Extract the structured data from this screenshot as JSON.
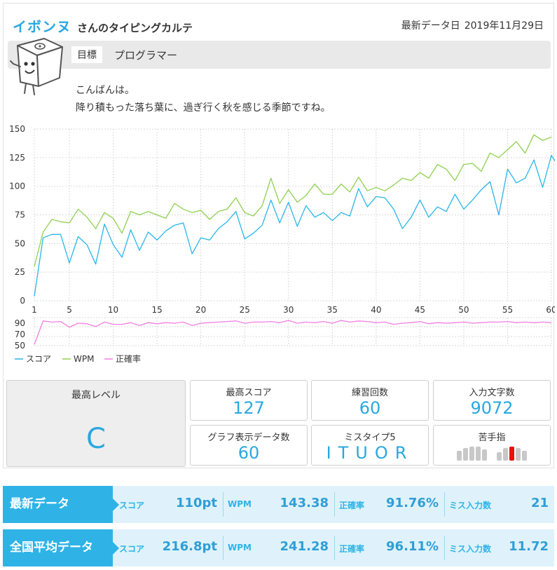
{
  "header": {
    "username": "イボンヌ",
    "suffix": "さんのタイピングカルテ",
    "date_label": "最新データ日",
    "date_value": "2019年11月29日"
  },
  "goal": {
    "label": "目標",
    "value": "プログラマー"
  },
  "message": {
    "line1": "こんばんは。",
    "line2": "降り積もった落ち葉に、過ぎ行く秋を感じる季節ですね。"
  },
  "colors": {
    "score": "#29b6e8",
    "wpm": "#8fd14f",
    "accuracy": "#f27ee1",
    "accent": "#29a8e0",
    "bar": "#2fb3e6"
  },
  "chart_data": {
    "type": "line",
    "x": [
      1,
      2,
      3,
      4,
      5,
      6,
      7,
      8,
      9,
      10,
      11,
      12,
      13,
      14,
      15,
      16,
      17,
      18,
      19,
      20,
      21,
      22,
      23,
      24,
      25,
      26,
      27,
      28,
      29,
      30,
      31,
      32,
      33,
      34,
      35,
      36,
      37,
      38,
      39,
      40,
      41,
      42,
      43,
      44,
      45,
      46,
      47,
      48,
      49,
      50,
      51,
      52,
      53,
      54,
      55,
      56,
      57,
      58,
      59,
      60
    ],
    "xticks": [
      1,
      5,
      10,
      15,
      20,
      25,
      30,
      35,
      40,
      45,
      50,
      55,
      60
    ],
    "top": {
      "ylim": [
        0,
        150
      ],
      "yticks": [
        0,
        25,
        50,
        75,
        100,
        125,
        150
      ],
      "series": [
        {
          "name": "スコア",
          "values": [
            4,
            55,
            58,
            58,
            33,
            56,
            49,
            32,
            67,
            49,
            38,
            62,
            44,
            60,
            53,
            61,
            66,
            68,
            41,
            55,
            53,
            63,
            69,
            78,
            54,
            59,
            66,
            88,
            68,
            86,
            65,
            83,
            73,
            77,
            70,
            77,
            74,
            98,
            82,
            91,
            90,
            80,
            63,
            73,
            88,
            73,
            82,
            78,
            93,
            80,
            88,
            97,
            104,
            75,
            115,
            103,
            107,
            123,
            99,
            127,
            115,
            110
          ]
        },
        {
          "name": "WPM",
          "values": [
            30,
            60,
            71,
            69,
            68,
            80,
            73,
            63,
            77,
            72,
            59,
            78,
            75,
            78,
            75,
            72,
            85,
            80,
            77,
            79,
            71,
            78,
            80,
            90,
            77,
            74,
            83,
            107,
            85,
            97,
            86,
            92,
            102,
            93,
            93,
            102,
            95,
            108,
            96,
            99,
            96,
            101,
            107,
            105,
            112,
            107,
            119,
            115,
            105,
            119,
            120,
            113,
            129,
            125,
            132,
            139,
            129,
            145,
            140,
            143
          ]
        }
      ]
    },
    "bottom": {
      "yticks": [
        50,
        70,
        90
      ],
      "series": [
        {
          "name": "正確率",
          "values": [
            52,
            94,
            92,
            93,
            83,
            90,
            89,
            84,
            92,
            88,
            88,
            91,
            86,
            91,
            89,
            91,
            90,
            92,
            86,
            90,
            91,
            92,
            93,
            94,
            90,
            92,
            92,
            93,
            91,
            95,
            90,
            92,
            91,
            93,
            90,
            95,
            92,
            94,
            93,
            91,
            92,
            88,
            90,
            91,
            93,
            89,
            91,
            90,
            91,
            92,
            90,
            91,
            92,
            92,
            93,
            91,
            92,
            91,
            92,
            91
          ]
        }
      ]
    },
    "legend": [
      "スコア",
      "WPM",
      "正確率"
    ],
    "grid": true
  },
  "stats": {
    "top_level": {
      "label": "最高レベル",
      "value": "C"
    },
    "max_score": {
      "label": "最高スコア",
      "value": "127"
    },
    "practice_count": {
      "label": "練習回数",
      "value": "60"
    },
    "char_count": {
      "label": "入力文字数",
      "value": "9072"
    },
    "graph_data_count": {
      "label": "グラフ表示データ数",
      "value": "60"
    },
    "miss_top5": {
      "label": "ミスタイプ5",
      "value": "ITUOR"
    },
    "weak_finger": {
      "label": "苦手指",
      "weak_index": 7
    }
  },
  "latest": {
    "title": "最新データ",
    "score_label": "スコア",
    "score": "110pt",
    "wpm_label": "WPM",
    "wpm": "143.38",
    "accuracy_label": "正確率",
    "accuracy": "91.76%",
    "miss_label": "ミス入力数",
    "miss": "21"
  },
  "national": {
    "title": "全国平均データ",
    "score_label": "スコア",
    "score": "216.8pt",
    "wpm_label": "WPM",
    "wpm": "241.28",
    "accuracy_label": "正確率",
    "accuracy": "96.11%",
    "miss_label": "ミス入力数",
    "miss": "11.72"
  }
}
